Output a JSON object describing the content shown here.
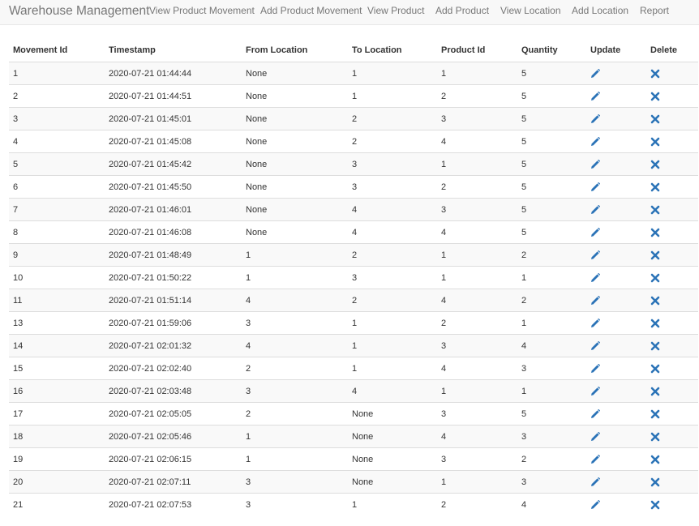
{
  "brand": "Warehouse Management",
  "nav": [
    "View Product Movement",
    "Add Product Movement",
    "View Product",
    "Add Product",
    "View Location",
    "Add Location",
    "Report"
  ],
  "colors": {
    "icon": "#2b73b7",
    "navbar_bg": "#f8f8f8",
    "row_stripe": "#f9f9f9"
  },
  "icons": {
    "update": "pencil-icon",
    "delete": "x-icon"
  },
  "table": {
    "headers": [
      "Movement Id",
      "Timestamp",
      "From Location",
      "To Location",
      "Product Id",
      "Quantity",
      "Update",
      "Delete"
    ],
    "rows": [
      [
        "1",
        "2020-07-21 01:44:44",
        "None",
        "1",
        "1",
        "5"
      ],
      [
        "2",
        "2020-07-21 01:44:51",
        "None",
        "1",
        "2",
        "5"
      ],
      [
        "3",
        "2020-07-21 01:45:01",
        "None",
        "2",
        "3",
        "5"
      ],
      [
        "4",
        "2020-07-21 01:45:08",
        "None",
        "2",
        "4",
        "5"
      ],
      [
        "5",
        "2020-07-21 01:45:42",
        "None",
        "3",
        "1",
        "5"
      ],
      [
        "6",
        "2020-07-21 01:45:50",
        "None",
        "3",
        "2",
        "5"
      ],
      [
        "7",
        "2020-07-21 01:46:01",
        "None",
        "4",
        "3",
        "5"
      ],
      [
        "8",
        "2020-07-21 01:46:08",
        "None",
        "4",
        "4",
        "5"
      ],
      [
        "9",
        "2020-07-21 01:48:49",
        "1",
        "2",
        "1",
        "2"
      ],
      [
        "10",
        "2020-07-21 01:50:22",
        "1",
        "3",
        "1",
        "1"
      ],
      [
        "11",
        "2020-07-21 01:51:14",
        "4",
        "2",
        "4",
        "2"
      ],
      [
        "13",
        "2020-07-21 01:59:06",
        "3",
        "1",
        "2",
        "1"
      ],
      [
        "14",
        "2020-07-21 02:01:32",
        "4",
        "1",
        "3",
        "4"
      ],
      [
        "15",
        "2020-07-21 02:02:40",
        "2",
        "1",
        "4",
        "3"
      ],
      [
        "16",
        "2020-07-21 02:03:48",
        "3",
        "4",
        "1",
        "1"
      ],
      [
        "17",
        "2020-07-21 02:05:05",
        "2",
        "None",
        "3",
        "5"
      ],
      [
        "18",
        "2020-07-21 02:05:46",
        "1",
        "None",
        "4",
        "3"
      ],
      [
        "19",
        "2020-07-21 02:06:15",
        "1",
        "None",
        "3",
        "2"
      ],
      [
        "20",
        "2020-07-21 02:07:11",
        "3",
        "None",
        "1",
        "3"
      ],
      [
        "21",
        "2020-07-21 02:07:53",
        "3",
        "1",
        "2",
        "4"
      ]
    ]
  }
}
